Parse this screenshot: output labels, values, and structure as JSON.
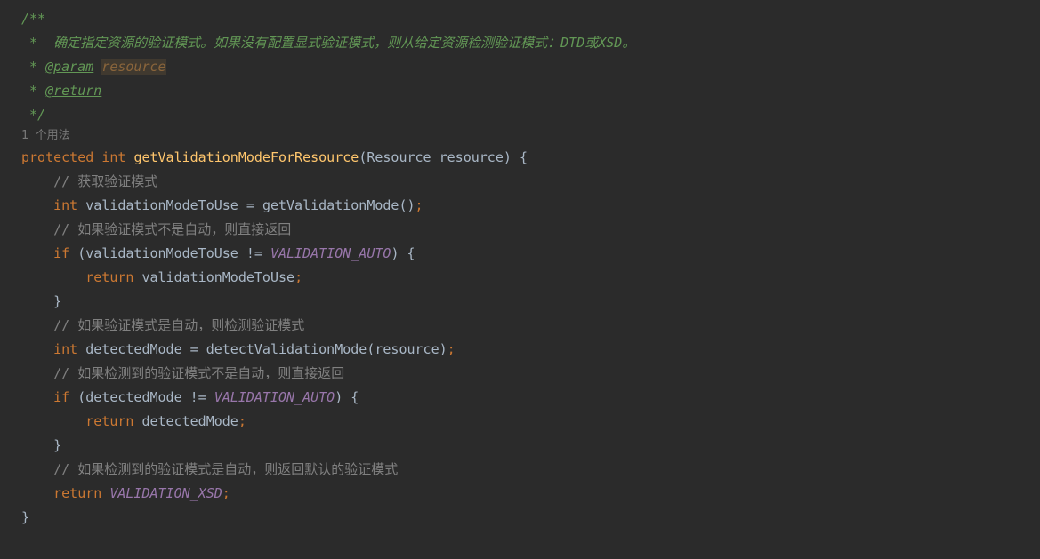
{
  "doc": {
    "open": "/**",
    "line1_prefix": " *  ",
    "desc": "确定指定资源的验证模式。如果没有配置显式验证模式，则从给定资源检测验证模式：DTD或XSD。",
    "tag_prefix": " * ",
    "param_tag": "@param",
    "param_name": "resource",
    "return_tag": "@return",
    "close": " */"
  },
  "usage_hint": "1 个用法",
  "sig": {
    "protected": "protected",
    "int": "int",
    "method": "getValidationModeForResource",
    "param_type": "Resource",
    "param_name": "resource"
  },
  "body": {
    "c1": "// 获取验证模式",
    "int_kw": "int",
    "var1": "validationModeToUse",
    "call1": "getValidationMode",
    "c2": "// 如果验证模式不是自动，则直接返回",
    "if_kw": "if",
    "neq": "!=",
    "auto": "VALIDATION_AUTO",
    "return_kw": "return",
    "c3": "// 如果验证模式是自动，则检测验证模式",
    "var2": "detectedMode",
    "call2": "detectValidationMode",
    "arg2": "resource",
    "c4": "// 如果检测到的验证模式不是自动，则直接返回",
    "c5": "// 如果检测到的验证模式是自动，则返回默认的验证模式",
    "xsd": "VALIDATION_XSD"
  }
}
